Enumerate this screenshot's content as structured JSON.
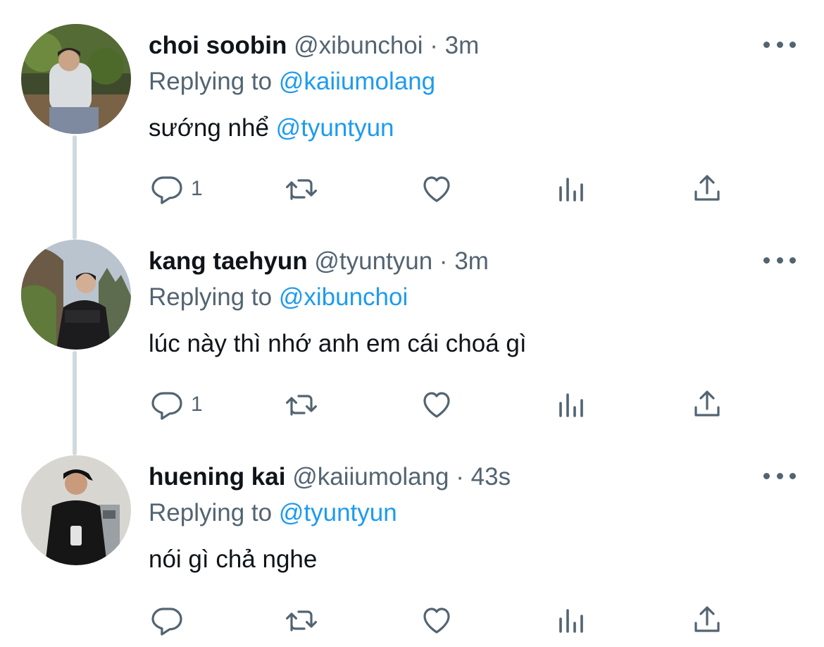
{
  "colors": {
    "text": "#0f1419",
    "secondary": "#536471",
    "accent": "#1d9bf0",
    "thread_line": "#cfd9de"
  },
  "tweets": [
    {
      "name": "choi soobin",
      "handle": "@xibunchoi",
      "separator": "·",
      "time": "3m",
      "replying_prefix": "Replying to",
      "replying_to": "@kaiiumolang",
      "text": "sướng nhể",
      "text_mention": "@tyuntyun",
      "reply_count": "1",
      "avatar_icon": "avatar-choi-soobin"
    },
    {
      "name": "kang taehyun",
      "handle": "@tyuntyun",
      "separator": "·",
      "time": "3m",
      "replying_prefix": "Replying to",
      "replying_to": "@xibunchoi",
      "text": "lúc này thì nhớ anh em cái choá gì",
      "text_mention": "",
      "reply_count": "1",
      "avatar_icon": "avatar-kang-taehyun"
    },
    {
      "name": "huening kai",
      "handle": "@kaiiumolang",
      "separator": "·",
      "time": "43s",
      "replying_prefix": "Replying to",
      "replying_to": "@tyuntyun",
      "text": "nói gì chả nghe",
      "text_mention": "",
      "reply_count": "",
      "avatar_icon": "avatar-huening-kai"
    }
  ],
  "action_icons": [
    "reply-icon",
    "retweet-icon",
    "like-icon",
    "views-icon",
    "share-icon"
  ]
}
